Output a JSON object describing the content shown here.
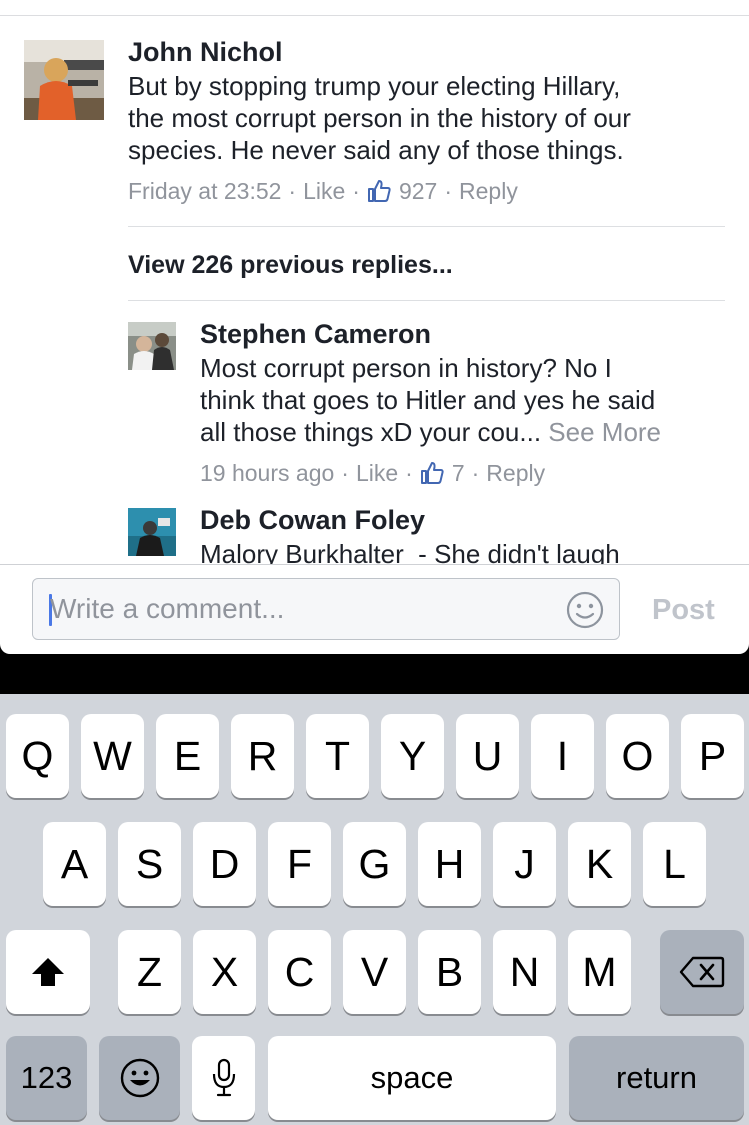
{
  "thread": {
    "comment": {
      "author": "John Nichol",
      "text_lines": [
        "But by stopping trump your electing Hillary,",
        "the most corrupt person in the history of our",
        "species. He never said any of those things."
      ],
      "time": "Friday at 23:52",
      "like_label": "Like",
      "like_count": "927",
      "reply_label": "Reply",
      "separator": "·"
    },
    "view_previous": "View 226 previous replies...",
    "replies": [
      {
        "author": "Stephen Cameron",
        "text_lines": [
          "Most corrupt person in history? No I",
          "think that goes to Hitler and yes he said",
          "all those things xD your cou..."
        ],
        "see_more": "See More",
        "time": "19 hours ago",
        "like_label": "Like",
        "like_count": "7",
        "reply_label": "Reply"
      },
      {
        "author": "Deb Cowan Foley",
        "text_lines": [
          "Malory Burkhalter  - She didn't laugh"
        ]
      }
    ]
  },
  "composer": {
    "placeholder": "Write a comment...",
    "value": "",
    "emoji_icon": "smiley-icon",
    "post_label": "Post"
  },
  "keyboard": {
    "row1": [
      "Q",
      "W",
      "E",
      "R",
      "T",
      "Y",
      "U",
      "I",
      "O",
      "P"
    ],
    "row2": [
      "A",
      "S",
      "D",
      "F",
      "G",
      "H",
      "J",
      "K",
      "L"
    ],
    "row3": [
      "Z",
      "X",
      "C",
      "V",
      "B",
      "N",
      "M"
    ],
    "numbers_label": "123",
    "space_label": "space",
    "return_label": "return"
  },
  "colors": {
    "name_text": "#1d2129",
    "meta_text": "#90949c",
    "like_icon": "#4267b2",
    "caret": "#4a78e6",
    "keyboard_bg": "#d1d5db"
  }
}
